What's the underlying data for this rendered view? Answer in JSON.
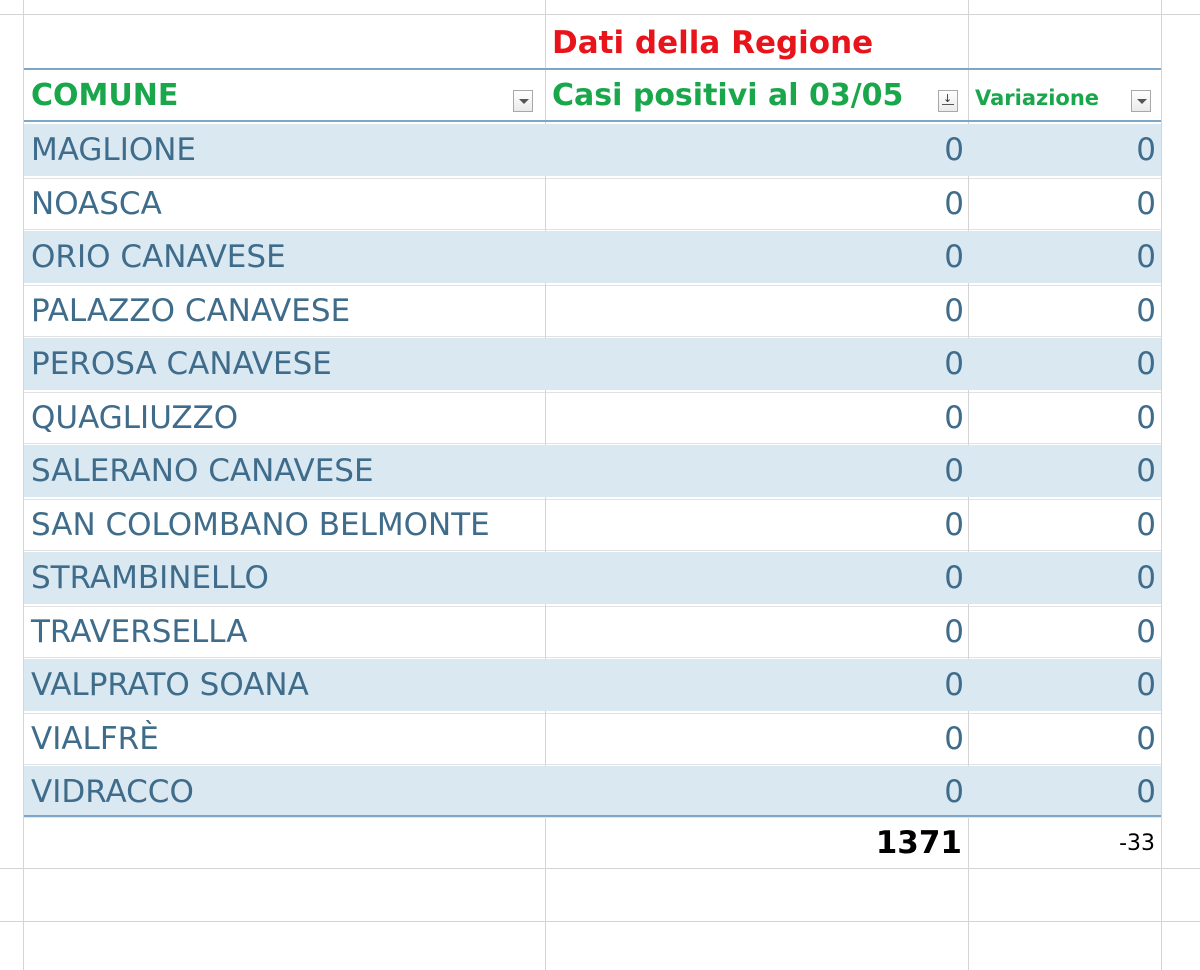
{
  "header": {
    "group_title": "Dati della Regione",
    "col_comune": "COMUNE",
    "col_casi": "Casi positivi al 03/05",
    "col_variazione": "Variazione"
  },
  "rows": [
    {
      "comune": "MAGLIONE",
      "casi": "0",
      "variazione": "0"
    },
    {
      "comune": "NOASCA",
      "casi": "0",
      "variazione": "0"
    },
    {
      "comune": "ORIO CANAVESE",
      "casi": "0",
      "variazione": "0"
    },
    {
      "comune": "PALAZZO CANAVESE",
      "casi": "0",
      "variazione": "0"
    },
    {
      "comune": "PEROSA CANAVESE",
      "casi": "0",
      "variazione": "0"
    },
    {
      "comune": "QUAGLIUZZO",
      "casi": "0",
      "variazione": "0"
    },
    {
      "comune": "SALERANO CANAVESE",
      "casi": "0",
      "variazione": "0"
    },
    {
      "comune": "SAN COLOMBANO BELMONTE",
      "casi": "0",
      "variazione": "0"
    },
    {
      "comune": "STRAMBINELLO",
      "casi": "0",
      "variazione": "0"
    },
    {
      "comune": "TRAVERSELLA",
      "casi": "0",
      "variazione": "0"
    },
    {
      "comune": "VALPRATO SOANA",
      "casi": "0",
      "variazione": "0"
    },
    {
      "comune": "VIALFRÈ",
      "casi": "0",
      "variazione": "0"
    },
    {
      "comune": "VIDRACCO",
      "casi": "0",
      "variazione": "0"
    }
  ],
  "totals": {
    "casi": "1371",
    "variazione": "-33"
  },
  "colors": {
    "header_green": "#1aa64a",
    "group_title_red": "#e8141c",
    "row_band": "#dae8f2",
    "row_text": "#3e6c8a"
  },
  "icons": {
    "comune_filter": "filter-dropdown-icon",
    "casi_filter": "sort-descending-filter-icon",
    "variazione_filter": "filter-dropdown-icon"
  }
}
